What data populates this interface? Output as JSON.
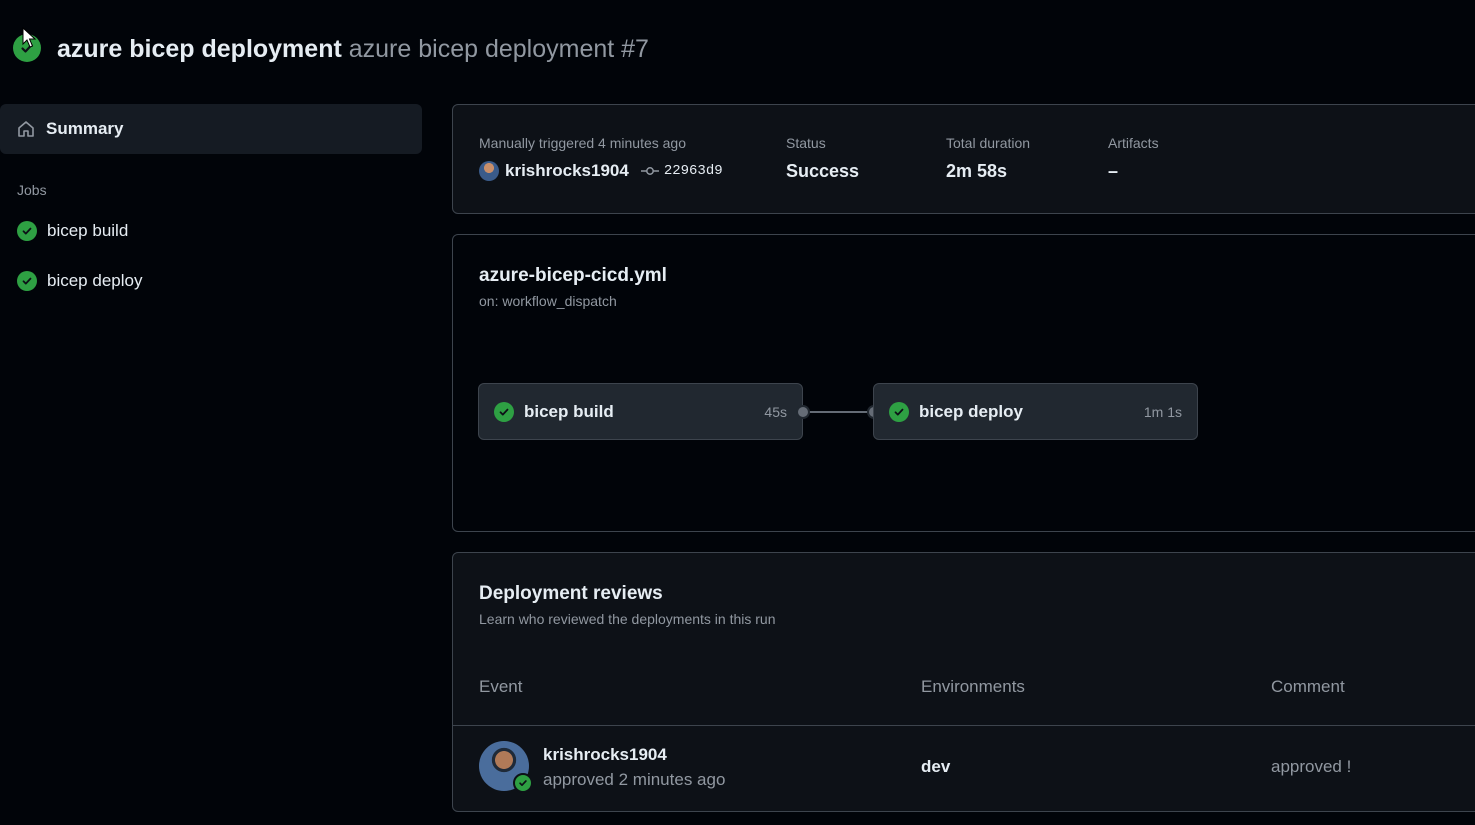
{
  "header": {
    "workflow_name": "azure bicep deployment",
    "run_title": "azure bicep deployment #7",
    "status_icon": "check-circle-fill-icon"
  },
  "sidebar": {
    "summary_label": "Summary",
    "jobs_heading": "Jobs",
    "jobs": [
      {
        "label": "bicep build",
        "status": "success"
      },
      {
        "label": "bicep deploy",
        "status": "success"
      }
    ]
  },
  "summary": {
    "trigger_label": "Manually triggered 4 minutes ago",
    "actor": "krishrocks1904",
    "commit": "22963d9",
    "status_label": "Status",
    "status_value": "Success",
    "duration_label": "Total duration",
    "duration_value": "2m 58s",
    "artifacts_label": "Artifacts",
    "artifacts_value": "–"
  },
  "workflow": {
    "file": "azure-bicep-cicd.yml",
    "trigger": "on: workflow_dispatch",
    "jobs": [
      {
        "name": "bicep build",
        "duration": "45s"
      },
      {
        "name": "bicep deploy",
        "duration": "1m 1s"
      }
    ]
  },
  "reviews": {
    "title": "Deployment reviews",
    "description": "Learn who reviewed the deployments in this run",
    "columns": [
      "Event",
      "Environments",
      "Comment"
    ],
    "rows": [
      {
        "actor": "krishrocks1904",
        "action": "approved 2 minutes ago",
        "environment": "dev",
        "comment": "approved !"
      }
    ]
  },
  "colors": {
    "background": "#010409",
    "success": "#2ea043",
    "border": "#3d444d",
    "muted_text": "#9198a1"
  }
}
